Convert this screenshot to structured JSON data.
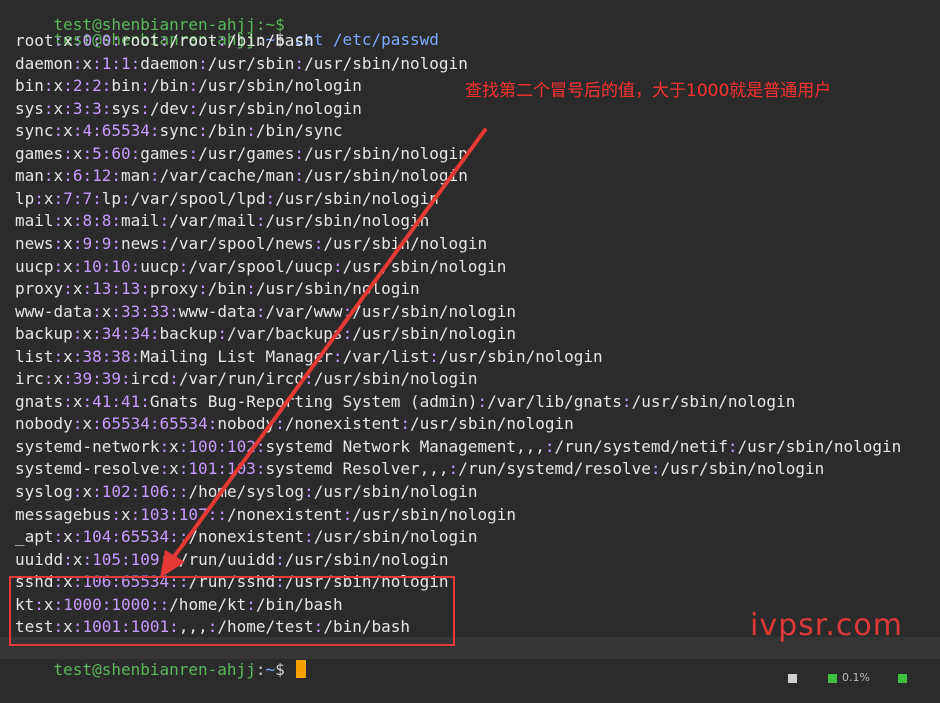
{
  "terminal": {
    "top_prompt_partial": "test@shenbianren-ahjj:~$",
    "prompt": {
      "user_host": "test@shenbianren-ahjj",
      "separator": ":",
      "path": "~",
      "symbol": "$"
    },
    "command": "cat /etc/passwd",
    "output": [
      "root:x:0:0:root:/root:/bin/bash",
      "daemon:x:1:1:daemon:/usr/sbin:/usr/sbin/nologin",
      "bin:x:2:2:bin:/bin:/usr/sbin/nologin",
      "sys:x:3:3:sys:/dev:/usr/sbin/nologin",
      "sync:x:4:65534:sync:/bin:/bin/sync",
      "games:x:5:60:games:/usr/games:/usr/sbin/nologin",
      "man:x:6:12:man:/var/cache/man:/usr/sbin/nologin",
      "lp:x:7:7:lp:/var/spool/lpd:/usr/sbin/nologin",
      "mail:x:8:8:mail:/var/mail:/usr/sbin/nologin",
      "news:x:9:9:news:/var/spool/news:/usr/sbin/nologin",
      "uucp:x:10:10:uucp:/var/spool/uucp:/usr/sbin/nologin",
      "proxy:x:13:13:proxy:/bin:/usr/sbin/nologin",
      "www-data:x:33:33:www-data:/var/www:/usr/sbin/nologin",
      "backup:x:34:34:backup:/var/backups:/usr/sbin/nologin",
      "list:x:38:38:Mailing List Manager:/var/list:/usr/sbin/nologin",
      "irc:x:39:39:ircd:/var/run/ircd:/usr/sbin/nologin",
      "gnats:x:41:41:Gnats Bug-Reporting System (admin):/var/lib/gnats:/usr/sbin/nologin",
      "nobody:x:65534:65534:nobody:/nonexistent:/usr/sbin/nologin",
      "systemd-network:x:100:102:systemd Network Management,,,:/run/systemd/netif:/usr/sbin/nologin",
      "systemd-resolve:x:101:103:systemd Resolver,,,:/run/systemd/resolve:/usr/sbin/nologin",
      "syslog:x:102:106::/home/syslog:/usr/sbin/nologin",
      "messagebus:x:103:107::/nonexistent:/usr/sbin/nologin",
      "_apt:x:104:65534::/nonexistent:/usr/sbin/nologin",
      "uuidd:x:105:109::/run/uuidd:/usr/sbin/nologin",
      "sshd:x:106:65534::/run/sshd:/usr/sbin/nologin",
      "kt:x:1000:1000::/home/kt:/bin/bash",
      "test:x:1001:1001:,,,:/home/test:/bin/bash"
    ]
  },
  "annotation": {
    "text": "查找第二个冒号后的值，大于1000就是普通用户",
    "color": "#ff3030"
  },
  "watermark": "ivpsr.com",
  "statusbar": {
    "text": "0.1%"
  }
}
